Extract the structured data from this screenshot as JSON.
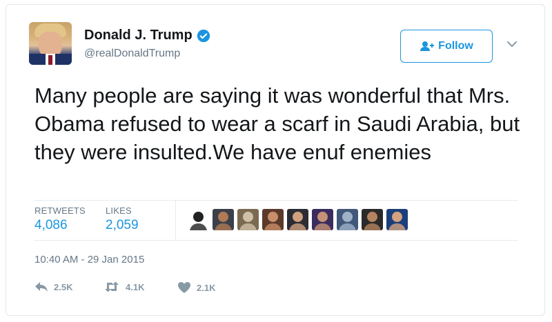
{
  "author": {
    "display_name": "Donald J. Trump",
    "handle": "@realDonaldTrump",
    "verified": true
  },
  "follow_button": {
    "label": "Follow"
  },
  "tweet": {
    "text": "Many people are saying it was wonderful that Mrs. Obama refused to wear a scarf in Saudi Arabia, but they were insulted.We have enuf enemies",
    "timestamp": "10:40 AM - 29 Jan 2015"
  },
  "stats": {
    "retweets_label": "RETWEETS",
    "retweets_value": "4,086",
    "likes_label": "LIKES",
    "likes_value": "2,059"
  },
  "likers": [
    {
      "name": "liker-avatar-1",
      "bg": "#ffffff",
      "fg": "#222222"
    },
    {
      "name": "liker-avatar-2",
      "bg": "#3b3f4a",
      "fg": "#b07a55"
    },
    {
      "name": "liker-avatar-3",
      "bg": "#7a6a52",
      "fg": "#cfc1a8"
    },
    {
      "name": "liker-avatar-4",
      "bg": "#5c3a2a",
      "fg": "#c98f6a"
    },
    {
      "name": "liker-avatar-5",
      "bg": "#2c2c34",
      "fg": "#d1a07f"
    },
    {
      "name": "liker-avatar-6",
      "bg": "#3a2d5e",
      "fg": "#c69176"
    },
    {
      "name": "liker-avatar-7",
      "bg": "#41587a",
      "fg": "#9fb2c9"
    },
    {
      "name": "liker-avatar-8",
      "bg": "#2a2a2a",
      "fg": "#b4835f"
    },
    {
      "name": "liker-avatar-9",
      "bg": "#1b3f7a",
      "fg": "#d4a181"
    }
  ],
  "actions": {
    "reply_count": "2.5K",
    "retweet_count": "4.1K",
    "like_count": "2.1K"
  },
  "colors": {
    "accent": "#1b95e0",
    "muted": "#657786",
    "action_gray": "#8899a6"
  }
}
